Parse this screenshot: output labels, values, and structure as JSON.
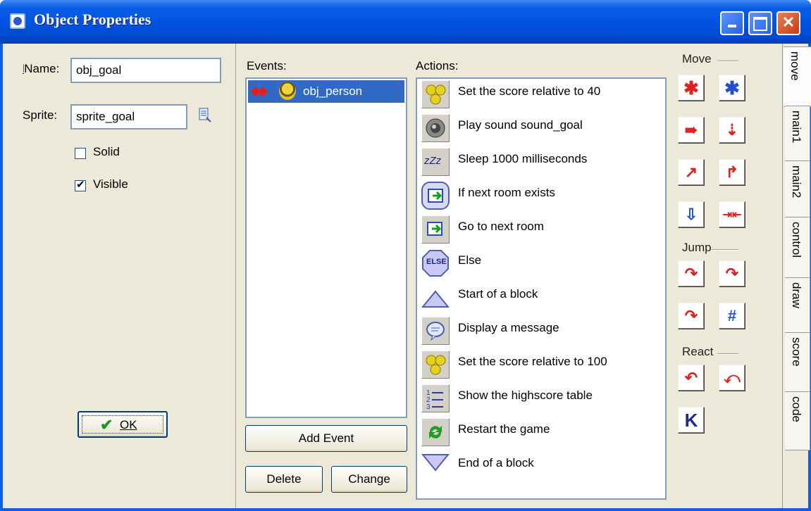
{
  "window": {
    "title": "Object Properties",
    "minimize": "_",
    "maximize": "□",
    "close": "✕"
  },
  "props": {
    "name_label": "Name:",
    "name_value": "obj_goal",
    "sprite_label": "Sprite:",
    "sprite_value": "sprite_goal",
    "solid_label": "Solid",
    "solid_checked": false,
    "visible_label": "Visible",
    "visible_checked": true,
    "ok_label": "OK"
  },
  "events": {
    "label": "Events:",
    "items": [
      {
        "label": "obj_person",
        "selected": true
      }
    ],
    "add_label": "Add Event",
    "delete_label": "Delete",
    "change_label": "Change"
  },
  "actions": {
    "label": "Actions:",
    "items": [
      {
        "label": "Set the score relative to 40",
        "icon": "score-icon"
      },
      {
        "label": "Play sound sound_goal",
        "icon": "speaker-icon"
      },
      {
        "label": "Sleep 1000 milliseconds",
        "icon": "sleep-icon"
      },
      {
        "label": "If next room exists",
        "icon": "if-next-room-icon"
      },
      {
        "label": "Go to next room",
        "icon": "next-room-icon"
      },
      {
        "label": "Else",
        "icon": "else-icon"
      },
      {
        "label": "Start of a block",
        "icon": "start-block-icon"
      },
      {
        "label": "Display a message",
        "icon": "message-icon"
      },
      {
        "label": "Set the score relative to 100",
        "icon": "score-icon"
      },
      {
        "label": "Show the highscore table",
        "icon": "highscore-icon"
      },
      {
        "label": "Restart the game",
        "icon": "restart-icon"
      },
      {
        "label": "End of a block",
        "icon": "end-block-icon"
      }
    ]
  },
  "palette": {
    "groups": [
      "Move",
      "Jump",
      "React"
    ],
    "else_text": "ELSE",
    "sleep_text": "zZz"
  },
  "tabs": [
    "move",
    "main1",
    "main2",
    "control",
    "draw",
    "score",
    "code"
  ],
  "colors": {
    "title_blue": "#0054e3",
    "client_bg": "#ece9d8",
    "selection": "#316ac5",
    "arrow_red": "#e02020",
    "arrow_blue": "#2050d0"
  }
}
